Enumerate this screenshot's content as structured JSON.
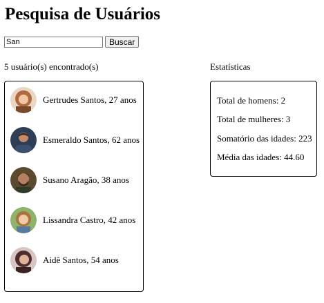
{
  "page": {
    "title": "Pesquisa de Usuários"
  },
  "search": {
    "value": "San",
    "button_label": "Buscar"
  },
  "results": {
    "heading": "5 usuário(s) encontrado(s)",
    "users": [
      {
        "label": "Gertrudes Santos, 27 anos",
        "avatar_colors": [
          "#c98a5e",
          "#7a4a2c"
        ]
      },
      {
        "label": "Esmeraldo Santos, 62 anos",
        "avatar_colors": [
          "#3b4f6e",
          "#c48b68"
        ]
      },
      {
        "label": "Susano Aragão, 38 anos",
        "avatar_colors": [
          "#6b5a3c",
          "#b58060"
        ]
      },
      {
        "label": "Lissandra Castro, 42 anos",
        "avatar_colors": [
          "#7fa35a",
          "#d9a56e"
        ]
      },
      {
        "label": "Aidê Santos, 54 anos",
        "avatar_colors": [
          "#4b2d2d",
          "#e0b39a"
        ]
      }
    ]
  },
  "stats": {
    "heading": "Estatísticas",
    "men": "Total de homens: 2",
    "women": "Total de mulheres: 3",
    "age_sum": "Somatório das idades: 223",
    "age_avg": "Média das idades: 44.60"
  }
}
